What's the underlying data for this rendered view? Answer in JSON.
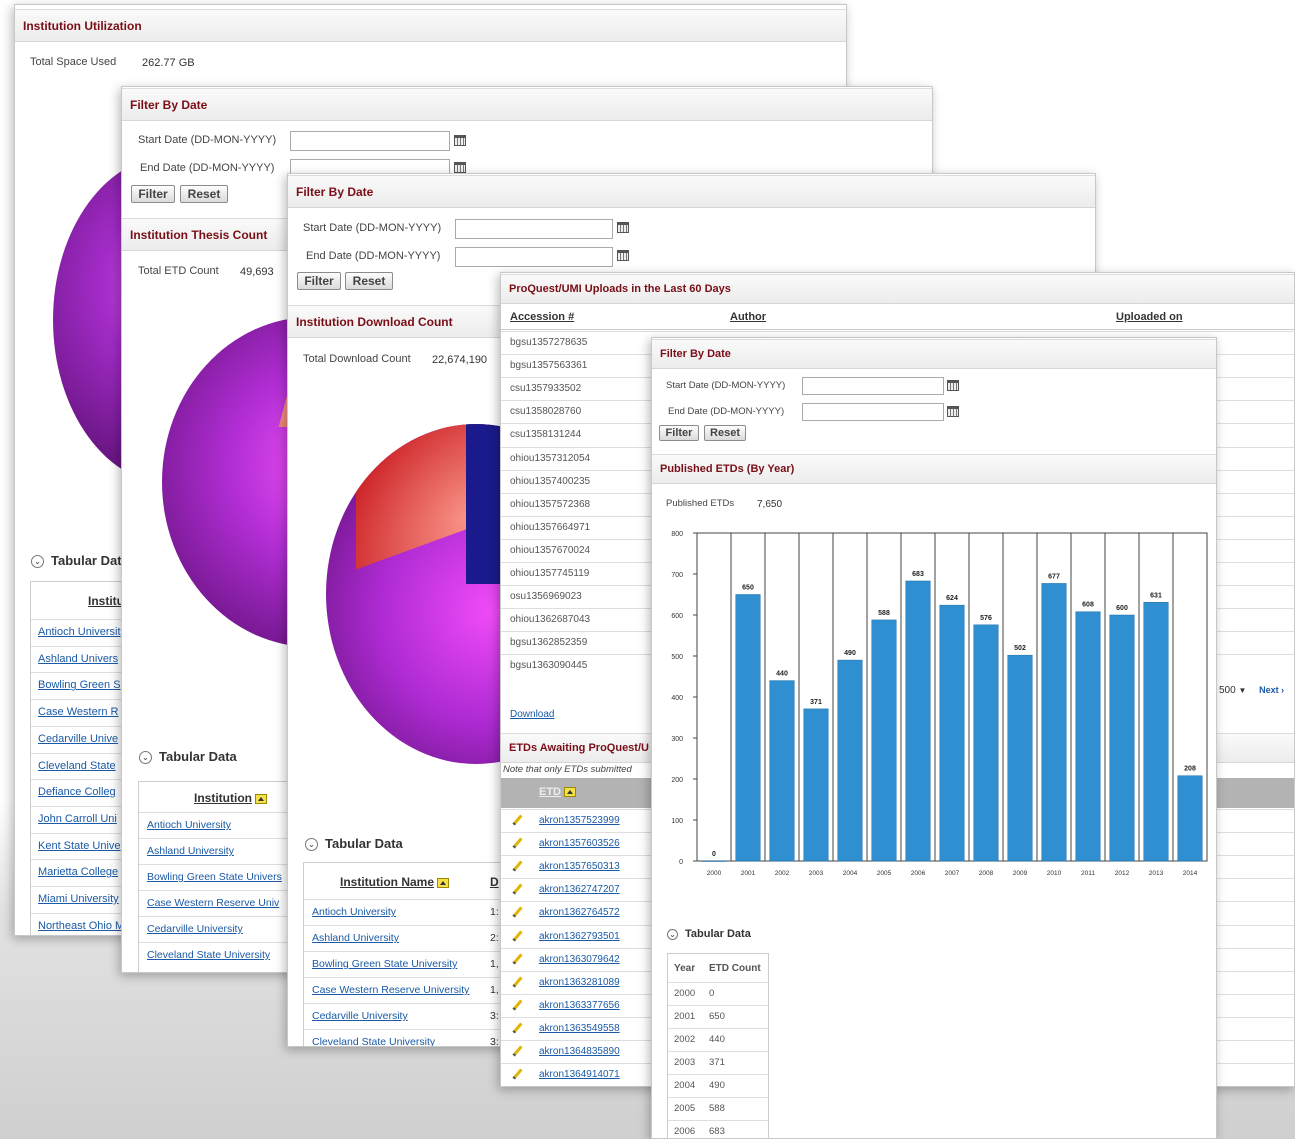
{
  "panel1": {
    "title": "Institution Utilization",
    "total_label": "Total Space Used",
    "total_value": "262.77 GB",
    "tabular": "Tabular Dat",
    "column": "Institu",
    "rows": [
      "Antioch Universit",
      "Ashland Univers",
      "Bowling Green S",
      "Case Western R",
      "Cedarville Unive",
      "Cleveland State",
      "Defiance Colleg",
      "John Carroll Uni",
      "Kent State Unive",
      "Marietta College",
      "Miami University",
      "Northeast Ohio M"
    ]
  },
  "panel2": {
    "filter_title": "Filter By Date",
    "start_label": "Start Date (DD-MON-YYYY)",
    "end_label": "End Date (DD-MON-YYYY)",
    "filter_btn": "Filter",
    "reset_btn": "Reset",
    "title": "Institution Thesis Count",
    "total_label": "Total ETD Count",
    "total_value": "49,693",
    "tabular": "Tabular Data",
    "column": "Institution",
    "rows": [
      "Antioch University",
      "Ashland University",
      "Bowling Green State Univers",
      "Case Western Reserve Univ",
      "Cedarville University",
      "Cleveland State University"
    ]
  },
  "panel3": {
    "filter_title": "Filter By Date",
    "start_label": "Start Date (DD-MON-YYYY)",
    "end_label": "End Date (DD-MON-YYYY)",
    "filter_btn": "Filter",
    "reset_btn": "Reset",
    "title": "Institution Download Count",
    "total_label": "Total Download Count",
    "total_value": "22,674,190",
    "tabular": "Tabular Data",
    "column": "Institution Name",
    "column2": "D",
    "rows": [
      "Antioch University",
      "Ashland University",
      "Bowling Green State University",
      "Case Western Reserve University",
      "Cedarville University",
      "Cleveland State University"
    ],
    "row_vals": [
      "1:",
      "2:",
      "1,",
      "1,",
      "3:",
      "3:"
    ]
  },
  "panel4": {
    "title": "ProQuest/UMI Uploads in the Last 60 Days",
    "col_accession": "Accession #",
    "col_author": "Author",
    "col_uploaded": "Uploaded on",
    "accessions": [
      "bgsu1357278635",
      "bgsu1357563361",
      "csu1357933502",
      "csu1358028760",
      "csu1358131244",
      "ohiou1357312054",
      "ohiou1357400235",
      "ohiou1357572368",
      "ohiou1357664971",
      "ohiou1357670024",
      "ohiou1357745119",
      "osu1356969023",
      "ohiou1362687043",
      "bgsu1362852359",
      "bgsu1363090445"
    ],
    "download": "Download",
    "pager_value": "500",
    "pager_next": "Next ›",
    "awaiting_title": "ETDs Awaiting ProQuest/U",
    "awaiting_note": "Note that only ETDs submitted",
    "col_etd": "ETD",
    "etds": [
      "akron1357523999",
      "akron1357603526",
      "akron1357650313",
      "akron1362747207",
      "akron1362764572",
      "akron1362793501",
      "akron1363079642",
      "akron1363281089",
      "akron1363377656",
      "akron1363549558",
      "akron1364835890",
      "akron1364914071"
    ]
  },
  "panel5": {
    "filter_title": "Filter By Date",
    "start_label": "Start Date (DD-MON-YYYY)",
    "end_label": "End Date (DD-MON-YYYY)",
    "filter_btn": "Filter",
    "reset_btn": "Reset",
    "title": "Published ETDs (By Year)",
    "total_label": "Published ETDs",
    "total_value": "7,650",
    "tabular": "Tabular Data",
    "col_year": "Year",
    "col_count": "ETD Count",
    "table_rows": [
      {
        "year": "2000",
        "count": "0"
      },
      {
        "year": "2001",
        "count": "650"
      },
      {
        "year": "2002",
        "count": "440"
      },
      {
        "year": "2003",
        "count": "371"
      },
      {
        "year": "2004",
        "count": "490"
      },
      {
        "year": "2005",
        "count": "588"
      },
      {
        "year": "2006",
        "count": "683"
      }
    ]
  },
  "colors": {
    "header_text": "#7a0e17",
    "link": "#1a5aa6",
    "bar": "#2f8fd0",
    "pie_purple": "#b52fd8",
    "pie_red": "#c8151c",
    "pie_navy": "#1a1a8c"
  },
  "chart_data": {
    "type": "bar",
    "categories": [
      "2000",
      "2001",
      "2002",
      "2003",
      "2004",
      "2005",
      "2006",
      "2007",
      "2008",
      "2009",
      "2010",
      "2011",
      "2012",
      "2013",
      "2014"
    ],
    "values": [
      0,
      650,
      440,
      371,
      490,
      588,
      683,
      624,
      576,
      502,
      677,
      608,
      600,
      631,
      208
    ],
    "ylim": [
      0,
      800
    ],
    "yticks": [
      0,
      100,
      200,
      300,
      400,
      500,
      600,
      700,
      800
    ],
    "grid": true
  }
}
